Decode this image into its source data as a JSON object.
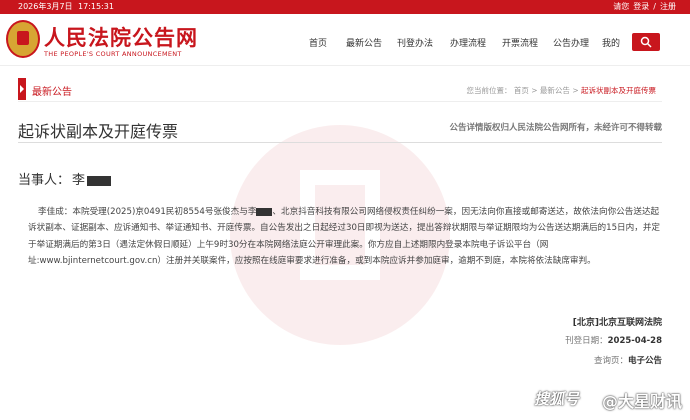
{
  "topbar": {
    "date": "2026年3月7日",
    "time": "17:15:31",
    "links": [
      "请您",
      "登录",
      "/",
      "注册"
    ]
  },
  "logo": {
    "cn": "人民法院公告网",
    "en": "THE PEOPLE'S COURT ANNOUNCEMENT"
  },
  "nav": [
    "首页",
    "最新公告",
    "刊登办法",
    "办理流程",
    "开票流程",
    "公告办理",
    "我的"
  ],
  "section": {
    "title": "最新公告",
    "crumb_prefix": "您当前位置：",
    "crumb": [
      "首页",
      "最新公告",
      "起诉状副本及开庭传票"
    ],
    "sep": ">"
  },
  "notice": {
    "title": "起诉状副本及开庭传票",
    "copyright": "公告详情版权归人民法院公告网所有，未经许可不得转载",
    "party_label": "当事人：",
    "party_name": "李",
    "body_1": "李佳成：本院受理(2025)京0491民初8554号张俊杰与李",
    "body_2": "、北京抖音科技有限公司网络侵权责任纠纷一案，因无法向你直接或邮寄送达，故依法向你公告送达起诉状副本、证据副本、应诉通知书、举证通知书、开庭传票。自公告发出之日起经过30日即视为送达，提出答辩状期限与举证期限均为公告送达期满后的15日内，并定于举证期满后的第3日（遇法定休假日顺延）上午9时30分在本院网络法庭公开审理此案。你方应自上述期限内登录本院电子诉讼平台（网址:www.bjinternetcourt.gov.cn）注册并关联案件，应按照在线庭审要求进行准备，或到本院应诉并参加庭审，逾期不到庭，本院将依法缺席审判。",
    "court": "[北京]北京互联网法院",
    "date_label": "刊登日期：",
    "date": "2025-04-28",
    "src_label": "查询页：",
    "src": "电子公告"
  },
  "watermark": {
    "left": "搜狐号",
    "right": "@大星财讯"
  },
  "colors": {
    "brand": "#c8161d"
  }
}
